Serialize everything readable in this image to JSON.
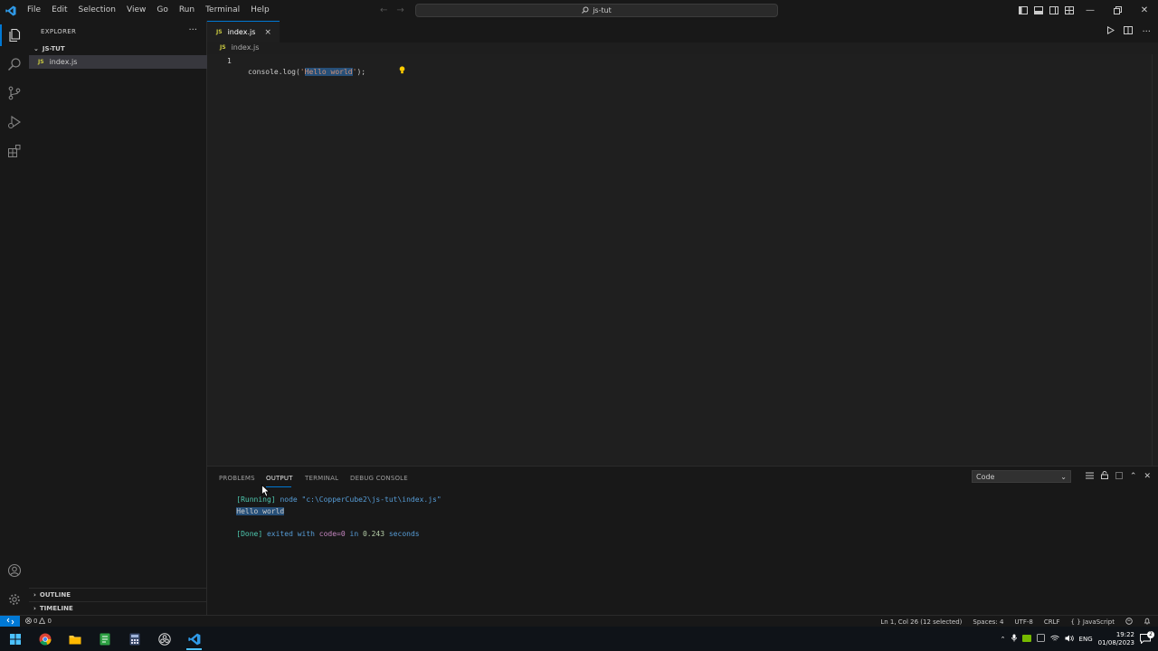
{
  "titlebar": {
    "menus": [
      "File",
      "Edit",
      "Selection",
      "View",
      "Go",
      "Run",
      "Terminal",
      "Help"
    ],
    "search_text": "js-tut",
    "icons": [
      "vscode-logo",
      "back-arrow-icon",
      "forward-arrow-icon",
      "search-icon",
      "toggle-sidebar-icon",
      "toggle-panel-icon",
      "toggle-secondary-sidebar-icon",
      "customize-layout-icon"
    ]
  },
  "activity_bar": {
    "items": [
      "explorer-icon",
      "search-icon",
      "source-control-icon",
      "run-debug-icon",
      "extensions-icon"
    ],
    "bottom": [
      "accounts-icon",
      "manage-gear-icon"
    ]
  },
  "sidebar": {
    "title": "EXPLORER",
    "more": "···",
    "folder": "JS-TUT",
    "files": [
      {
        "badge": "JS",
        "name": "index.js"
      }
    ],
    "sections": [
      "OUTLINE",
      "TIMELINE"
    ]
  },
  "editor": {
    "tab": {
      "badge": "JS",
      "name": "index.js",
      "close": "×"
    },
    "breadcrumb": {
      "badge": "JS",
      "file": "index.js"
    },
    "line_number": "1",
    "code": {
      "prefix": "console.log(",
      "quote_open": "'",
      "selected": "Hello world",
      "quote_close": "'",
      "suffix": ");"
    }
  },
  "panel": {
    "tabs": [
      "PROBLEMS",
      "OUTPUT",
      "TERMINAL",
      "DEBUG CONSOLE"
    ],
    "active_tab": "OUTPUT",
    "channel": "Code",
    "output": {
      "running_prefix": "[Running] ",
      "running_cmd": "node \"c:\\CopperCube2\\js-tut\\index.js\"",
      "hello": "Hello world",
      "done_prefix": "[Done] ",
      "done_text1": "exited with ",
      "done_code": "code=0",
      "done_text2": " in ",
      "done_time": "0.243",
      "done_text3": " seconds"
    }
  },
  "statusbar": {
    "errors": "0",
    "warnings": "0",
    "position": "Ln 1, Col 26 (12 selected)",
    "spaces": "Spaces: 4",
    "encoding": "UTF-8",
    "eol": "CRLF",
    "language_braces": "{ }",
    "language": "JavaScript"
  },
  "taskbar": {
    "apps": [
      "windows-start-icon",
      "chrome-icon",
      "file-explorer-icon",
      "notepad-icon",
      "calculator-icon",
      "obs-icon",
      "vscode-icon"
    ],
    "lang": "ENG",
    "time": "19:22",
    "date": "01/08/2023",
    "notifications": "2"
  },
  "colors": {
    "accent": "#0078d4",
    "selection": "#264f78",
    "string": "#ce9178",
    "js_badge": "#cbcb41"
  }
}
